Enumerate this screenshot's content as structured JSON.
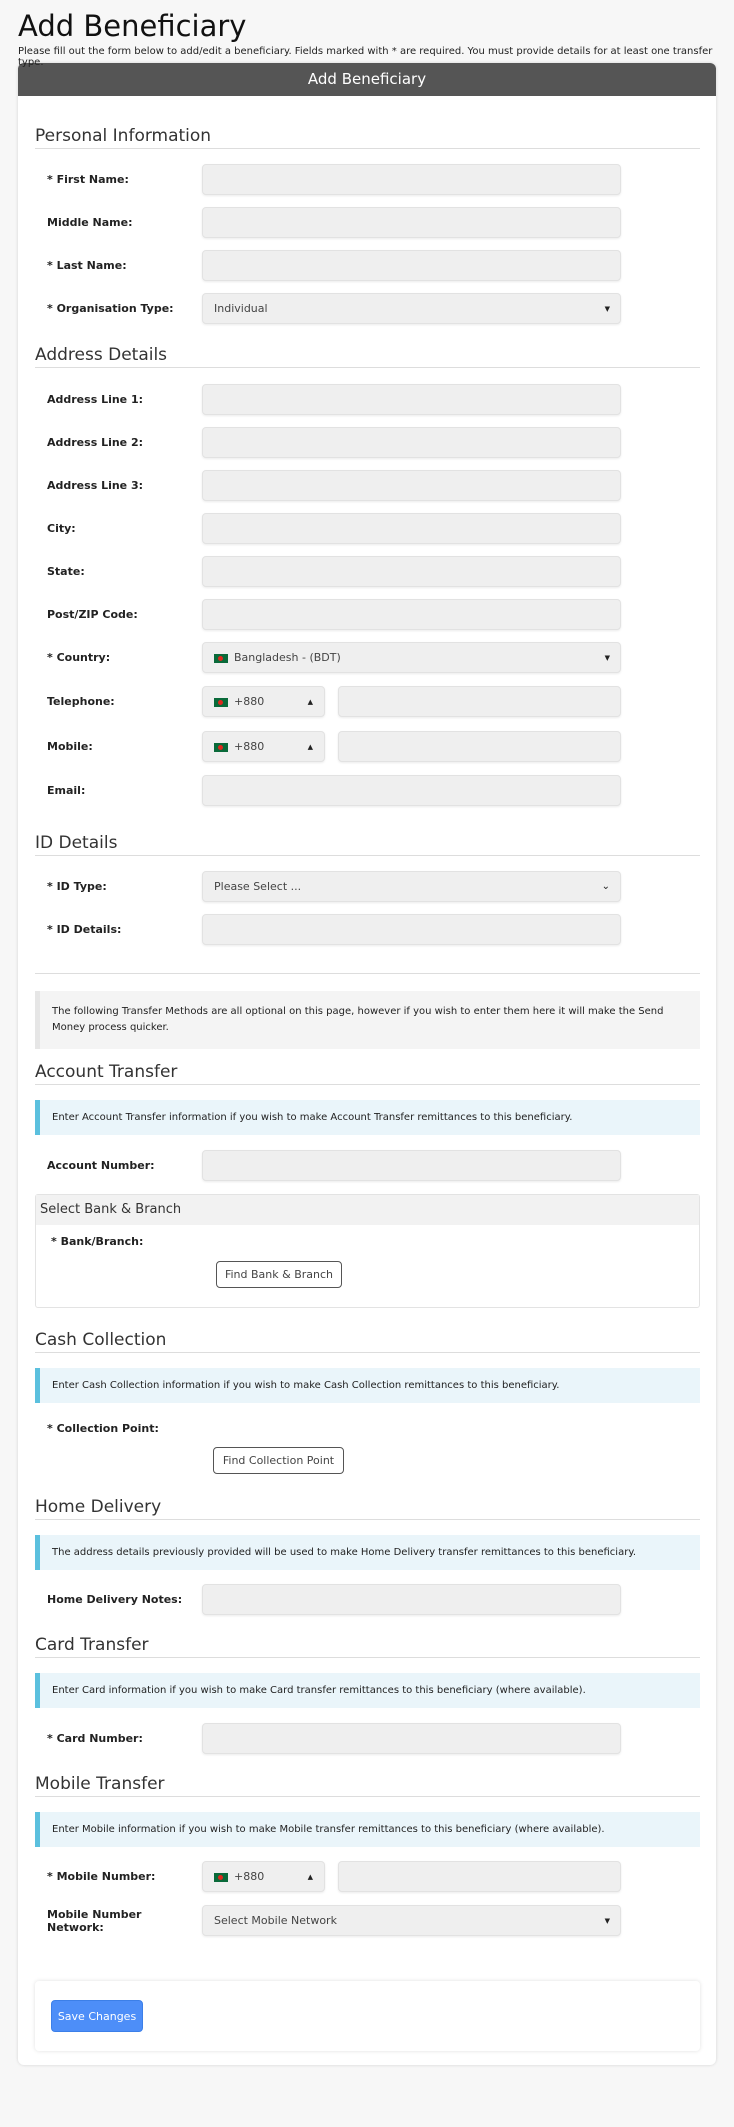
{
  "page": {
    "title": "Add Beneficiary",
    "intro": "Please fill out the form below to add/edit a beneficiary. Fields marked with * are required. You must provide details for at least one transfer type.",
    "card_title": "Add Beneficiary"
  },
  "personal": {
    "heading": "Personal Information",
    "first_name": "* First Name:",
    "middle_name": "Middle Name:",
    "last_name": "* Last Name:",
    "org_type_label": "* Organisation Type:",
    "org_type_value": "Individual"
  },
  "address": {
    "heading": "Address Details",
    "line1": "Address Line 1:",
    "line2": "Address Line 2:",
    "line3": "Address Line 3:",
    "city": "City:",
    "state": "State:",
    "zip": "Post/ZIP Code:",
    "country_label": "* Country:",
    "country_value": "Bangladesh - (BDT)",
    "telephone": "Telephone:",
    "telephone_code": "+880",
    "mobile": "Mobile:",
    "mobile_code": "+880",
    "email": "Email:"
  },
  "id": {
    "heading": "ID Details",
    "type_label": "* ID Type:",
    "type_value": "Please Select ...",
    "details_label": "* ID Details:"
  },
  "transfer_note": "The following Transfer Methods are all optional on this page, however if you wish to enter them here it will make the Send Money process quicker.",
  "account_transfer": {
    "heading": "Account Transfer",
    "info": "Enter Account Transfer information if you wish to make Account Transfer remittances to this beneficiary.",
    "account_number": "Account Number:",
    "bank_heading": "Select Bank & Branch",
    "bank_label": "* Bank/Branch:",
    "bank_button": "Find Bank & Branch"
  },
  "cash_collection": {
    "heading": "Cash Collection",
    "info": "Enter Cash Collection information if you wish to make Cash Collection remittances to this beneficiary.",
    "point_label": "* Collection Point:",
    "point_button": "Find Collection Point"
  },
  "home_delivery": {
    "heading": "Home Delivery",
    "info": "The address details previously provided will be used to make Home Delivery transfer remittances to this beneficiary.",
    "notes_label": "Home Delivery Notes:"
  },
  "card_transfer": {
    "heading": "Card Transfer",
    "info": "Enter Card information if you wish to make Card transfer remittances to this beneficiary (where available).",
    "card_label": "* Card Number:"
  },
  "mobile_transfer": {
    "heading": "Mobile Transfer",
    "info": "Enter Mobile information if you wish to make Mobile transfer remittances to this beneficiary (where available).",
    "number_label": "* Mobile Number:",
    "number_code": "+880",
    "network_label": "Mobile Number Network:",
    "network_value": "Select Mobile Network"
  },
  "actions": {
    "save": "Save Changes"
  },
  "colors": {
    "header_bg": "#555555",
    "info_border": "#5bc0de",
    "primary": "#4d8ef8"
  }
}
